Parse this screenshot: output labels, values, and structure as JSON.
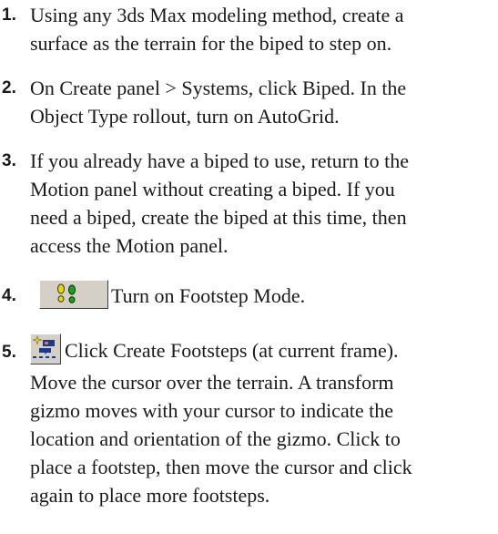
{
  "steps": [
    {
      "number": "1.",
      "lines": [
        "Using any 3ds Max modeling method, create a",
        "surface as the terrain for the biped to step on."
      ]
    },
    {
      "number": "2.",
      "lines": [
        "On Create panel > Systems, click Biped. In the",
        "Object Type rollout, turn on AutoGrid."
      ]
    },
    {
      "number": "3.",
      "lines": [
        "If you already have a biped to use, return to the",
        "Motion panel without creating a biped.  If you",
        "need a biped, create the biped at this time, then",
        "access the Motion panel."
      ]
    },
    {
      "number": "4.",
      "icon": "footstep-mode-icon",
      "lines": [
        "Turn on Footstep Mode."
      ]
    },
    {
      "number": "5.",
      "icon": "create-footsteps-icon",
      "lines": [
        "Click Create Footsteps (at current frame).",
        "Move the cursor over the terrain. A transform",
        "gizmo moves with your cursor to indicate the",
        "location and orientation of the gizmo. Click to",
        "place a footstep, then move the cursor and click",
        "again to place more footsteps."
      ]
    }
  ]
}
